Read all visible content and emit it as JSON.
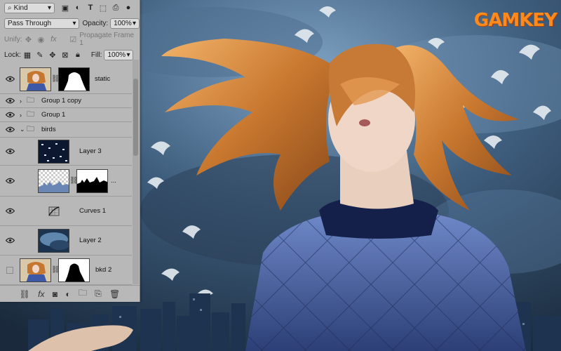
{
  "watermark": "GAMKEY",
  "panel": {
    "filter_kind": "Kind",
    "blend_mode": "Pass Through",
    "opacity_label": "Opacity:",
    "opacity_value": "100%",
    "unify_label": "Unify:",
    "propagate_label": "Propagate Frame 1",
    "lock_label": "Lock:",
    "fill_label": "Fill:",
    "fill_value": "100%"
  },
  "layers": [
    {
      "name": "static",
      "visible": true
    },
    {
      "name": "Group 1 copy",
      "visible": true
    },
    {
      "name": "Group 1",
      "visible": true
    },
    {
      "name": "birds",
      "visible": true
    },
    {
      "name": "Layer 3",
      "visible": true
    },
    {
      "name": "...",
      "visible": true
    },
    {
      "name": "Curves 1",
      "visible": true
    },
    {
      "name": "Layer 2",
      "visible": true
    },
    {
      "name": "bkd 2",
      "visible": false
    }
  ],
  "bottom_icons": [
    "link-icon",
    "fx-icon",
    "mask-icon",
    "adjustment-icon",
    "folder-icon",
    "new-layer-icon",
    "trash-icon"
  ]
}
